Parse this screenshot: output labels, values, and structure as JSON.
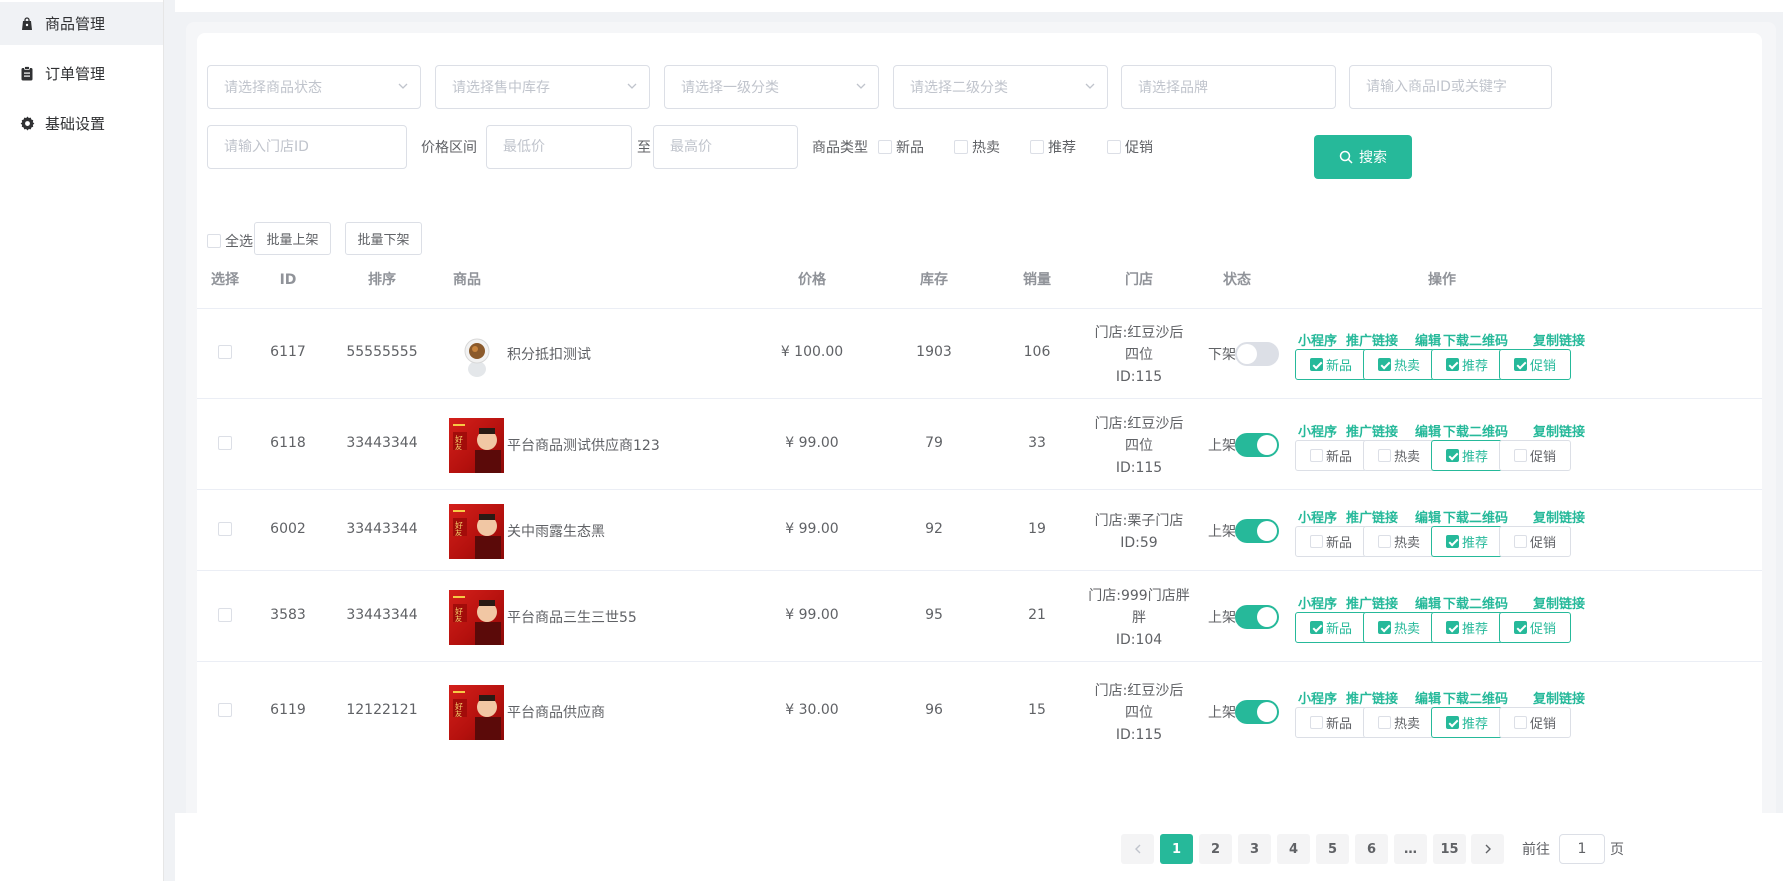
{
  "sidebar": {
    "items": [
      {
        "label": "商品管理",
        "icon": "bag-icon",
        "active": true
      },
      {
        "label": "订单管理",
        "icon": "clipboard-icon",
        "active": false
      },
      {
        "label": "基础设置",
        "icon": "gear-icon",
        "active": false
      }
    ]
  },
  "filters": {
    "status_placeholder": "请选择商品状态",
    "stock_placeholder": "请选择售中库存",
    "cat1_placeholder": "请选择一级分类",
    "cat2_placeholder": "请选择二级分类",
    "brand_placeholder": "请选择品牌",
    "keyword_placeholder": "请输入商品ID或关键字",
    "store_placeholder": "请输入门店ID",
    "price_label": "价格区间",
    "min_price_placeholder": "最低价",
    "to_label": "至",
    "max_price_placeholder": "最高价",
    "type_label": "商品类型",
    "type_options": [
      "新品",
      "热卖",
      "推荐",
      "促销"
    ],
    "search_label": "搜索"
  },
  "toolbar": {
    "select_all": "全选",
    "batch_up": "批量上架",
    "batch_down": "批量下架"
  },
  "table": {
    "headers": {
      "select": "选择",
      "id": "ID",
      "sort": "排序",
      "product": "商品",
      "price": "价格",
      "stock": "库存",
      "sales": "销量",
      "store": "门店",
      "status": "状态",
      "ops": "操作"
    },
    "op_links": [
      "小程序",
      "推广链接",
      "编辑",
      "下载二维码",
      "复制链接"
    ],
    "op_tags": [
      "新品",
      "热卖",
      "推荐",
      "促销"
    ],
    "rows": [
      {
        "id": "6117",
        "sort": "55555555",
        "name": "积分抵扣测试",
        "price": "¥ 100.00",
        "stock": "1903",
        "sales": "106",
        "store_lines": [
          "门店:红豆沙后",
          "四位",
          "ID:115"
        ],
        "status": "下架",
        "on": false,
        "thumb": "astronaut",
        "tags": [
          true,
          true,
          true,
          true
        ]
      },
      {
        "id": "6118",
        "sort": "33443344",
        "name": "平台商品测试供应商123",
        "price": "¥ 99.00",
        "stock": "79",
        "sales": "33",
        "store_lines": [
          "门店:红豆沙后",
          "四位",
          "ID:115"
        ],
        "status": "上架",
        "on": true,
        "thumb": "red",
        "tags": [
          false,
          false,
          true,
          false
        ]
      },
      {
        "id": "6002",
        "sort": "33443344",
        "name": "关中雨露生态黑",
        "price": "¥ 99.00",
        "stock": "92",
        "sales": "19",
        "store_lines": [
          "门店:栗子门店",
          "ID:59"
        ],
        "status": "上架",
        "on": true,
        "thumb": "red",
        "tags": [
          false,
          false,
          true,
          false
        ]
      },
      {
        "id": "3583",
        "sort": "33443344",
        "name": "平台商品三生三世55",
        "price": "¥ 99.00",
        "stock": "95",
        "sales": "21",
        "store_lines": [
          "门店:999门店胖",
          "胖",
          "ID:104"
        ],
        "status": "上架",
        "on": true,
        "thumb": "red",
        "tags": [
          true,
          true,
          true,
          true
        ]
      },
      {
        "id": "6119",
        "sort": "12122121",
        "name": "平台商品供应商",
        "price": "¥ 30.00",
        "stock": "96",
        "sales": "15",
        "store_lines": [
          "门店:红豆沙后",
          "四位",
          "ID:115"
        ],
        "status": "上架",
        "on": true,
        "thumb": "red",
        "tags": [
          false,
          false,
          true,
          false
        ]
      }
    ]
  },
  "pagination": {
    "pages": [
      "1",
      "2",
      "3",
      "4",
      "5",
      "6",
      "…",
      "15"
    ],
    "current": "1",
    "goto_label": "前往",
    "goto_value": "1",
    "page_unit": "页"
  },
  "colors": {
    "accent": "#26b99a"
  }
}
